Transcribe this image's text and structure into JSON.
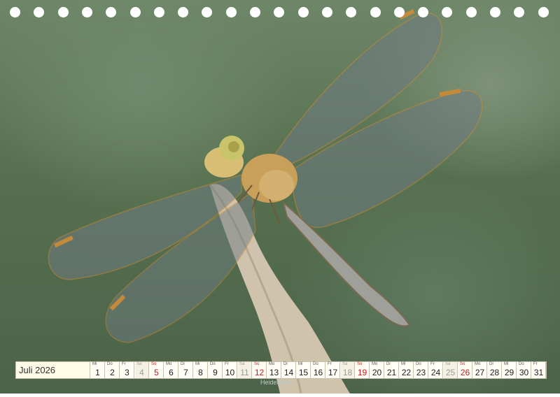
{
  "month_label": "Juli 2026",
  "credit": "Heidelibelle",
  "days": [
    {
      "wd": "Mi",
      "d": "1",
      "type": ""
    },
    {
      "wd": "Do",
      "d": "2",
      "type": ""
    },
    {
      "wd": "Fr",
      "d": "3",
      "type": ""
    },
    {
      "wd": "Sa",
      "d": "4",
      "type": "hol"
    },
    {
      "wd": "So",
      "d": "5",
      "type": "sun"
    },
    {
      "wd": "Mo",
      "d": "6",
      "type": ""
    },
    {
      "wd": "Di",
      "d": "7",
      "type": ""
    },
    {
      "wd": "Mi",
      "d": "8",
      "type": ""
    },
    {
      "wd": "Do",
      "d": "9",
      "type": ""
    },
    {
      "wd": "Fr",
      "d": "10",
      "type": ""
    },
    {
      "wd": "Sa",
      "d": "11",
      "type": "hol"
    },
    {
      "wd": "So",
      "d": "12",
      "type": "sun"
    },
    {
      "wd": "Mo",
      "d": "13",
      "type": ""
    },
    {
      "wd": "Di",
      "d": "14",
      "type": ""
    },
    {
      "wd": "Mi",
      "d": "15",
      "type": ""
    },
    {
      "wd": "Do",
      "d": "16",
      "type": ""
    },
    {
      "wd": "Fr",
      "d": "17",
      "type": ""
    },
    {
      "wd": "Sa",
      "d": "18",
      "type": "hol"
    },
    {
      "wd": "So",
      "d": "19",
      "type": "sun"
    },
    {
      "wd": "Mo",
      "d": "20",
      "type": ""
    },
    {
      "wd": "Di",
      "d": "21",
      "type": ""
    },
    {
      "wd": "Mi",
      "d": "22",
      "type": ""
    },
    {
      "wd": "Do",
      "d": "23",
      "type": ""
    },
    {
      "wd": "Fr",
      "d": "24",
      "type": ""
    },
    {
      "wd": "Sa",
      "d": "25",
      "type": "hol"
    },
    {
      "wd": "So",
      "d": "26",
      "type": "sun"
    },
    {
      "wd": "Mo",
      "d": "27",
      "type": ""
    },
    {
      "wd": "Di",
      "d": "28",
      "type": ""
    },
    {
      "wd": "Mi",
      "d": "29",
      "type": ""
    },
    {
      "wd": "Do",
      "d": "30",
      "type": ""
    },
    {
      "wd": "Fr",
      "d": "31",
      "type": ""
    }
  ],
  "colors": {
    "sunday": "#d0161b",
    "saturday": "#9a9a9a",
    "dragonfly_body": "#c8a05a",
    "grass": "#d8cbb8"
  }
}
